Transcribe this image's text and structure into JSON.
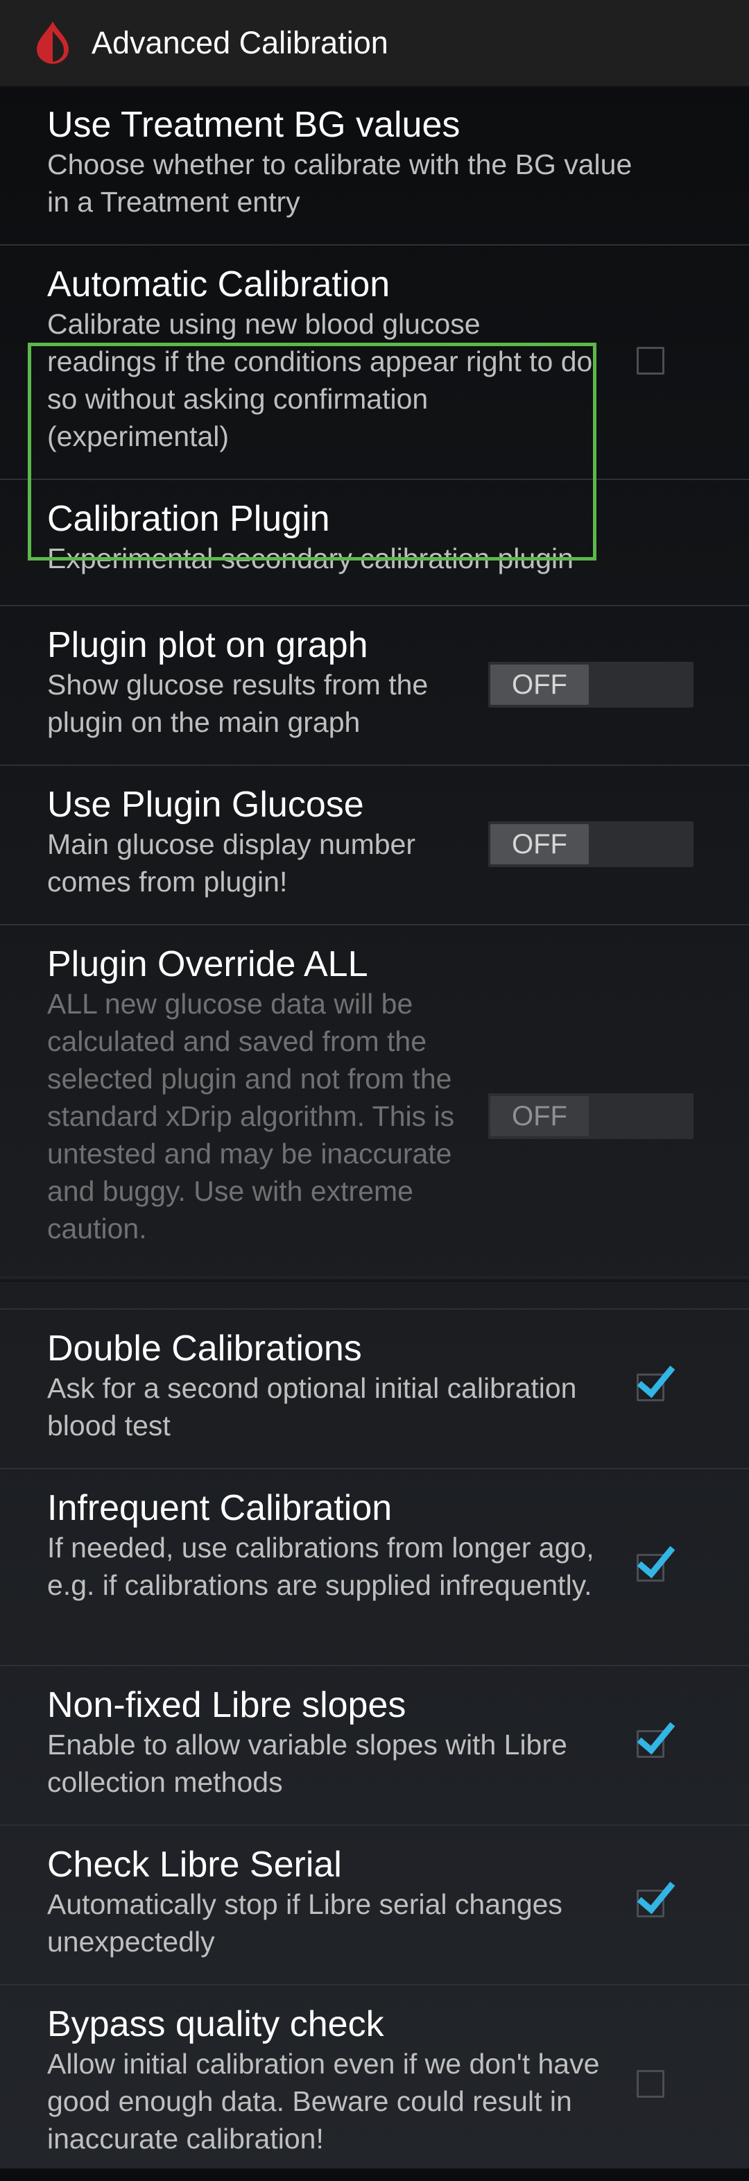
{
  "header": {
    "title": "Advanced Calibration",
    "icon": "blood-drop-icon"
  },
  "highlight_color": "#5cb84a",
  "accent_color": "#33b5e5",
  "items": [
    {
      "title": "Use Treatment BG values",
      "summary": "Choose whether to calibrate with the BG value in a Treatment entry",
      "control": "none"
    },
    {
      "title": "Automatic Calibration",
      "summary": "Calibrate using new blood glucose readings if the conditions appear right to do so without asking confirmation (experimental)",
      "control": "checkbox",
      "checked": false
    },
    {
      "title": "Calibration Plugin",
      "summary": "Experimental secondary calibration plugin",
      "control": "none"
    },
    {
      "title": "Plugin plot on graph",
      "summary": "Show glucose results from the plugin on the main graph",
      "control": "switch",
      "state": "OFF"
    },
    {
      "title": "Use Plugin Glucose",
      "summary": "Main glucose display number comes from plugin!",
      "control": "switch",
      "state": "OFF"
    },
    {
      "title": "Plugin Override ALL",
      "summary": "ALL new glucose data will be calculated and saved from the selected plugin and not from the standard xDrip algorithm. This is untested and may be inaccurate and buggy. Use with extreme caution.",
      "control": "switch",
      "state": "OFF",
      "enabled": false
    },
    {
      "title": "Double Calibrations",
      "summary": "Ask for a second optional initial calibration blood test",
      "control": "checkbox",
      "checked": true
    },
    {
      "title": "Infrequent Calibration",
      "summary": "If needed, use calibrations from longer ago, e.g. if calibrations are supplied infrequently.",
      "control": "checkbox",
      "checked": true
    },
    {
      "title": "Non-fixed Libre slopes",
      "summary": "Enable to allow variable slopes with Libre collection methods",
      "control": "checkbox",
      "checked": true
    },
    {
      "title": "Check Libre Serial",
      "summary": "Automatically stop if Libre serial changes unexpectedly",
      "control": "checkbox",
      "checked": true
    },
    {
      "title": "Bypass quality check",
      "summary": "Allow initial calibration even if we don't have good enough data. Beware could result in inaccurate calibration!",
      "control": "checkbox",
      "checked": false
    }
  ]
}
